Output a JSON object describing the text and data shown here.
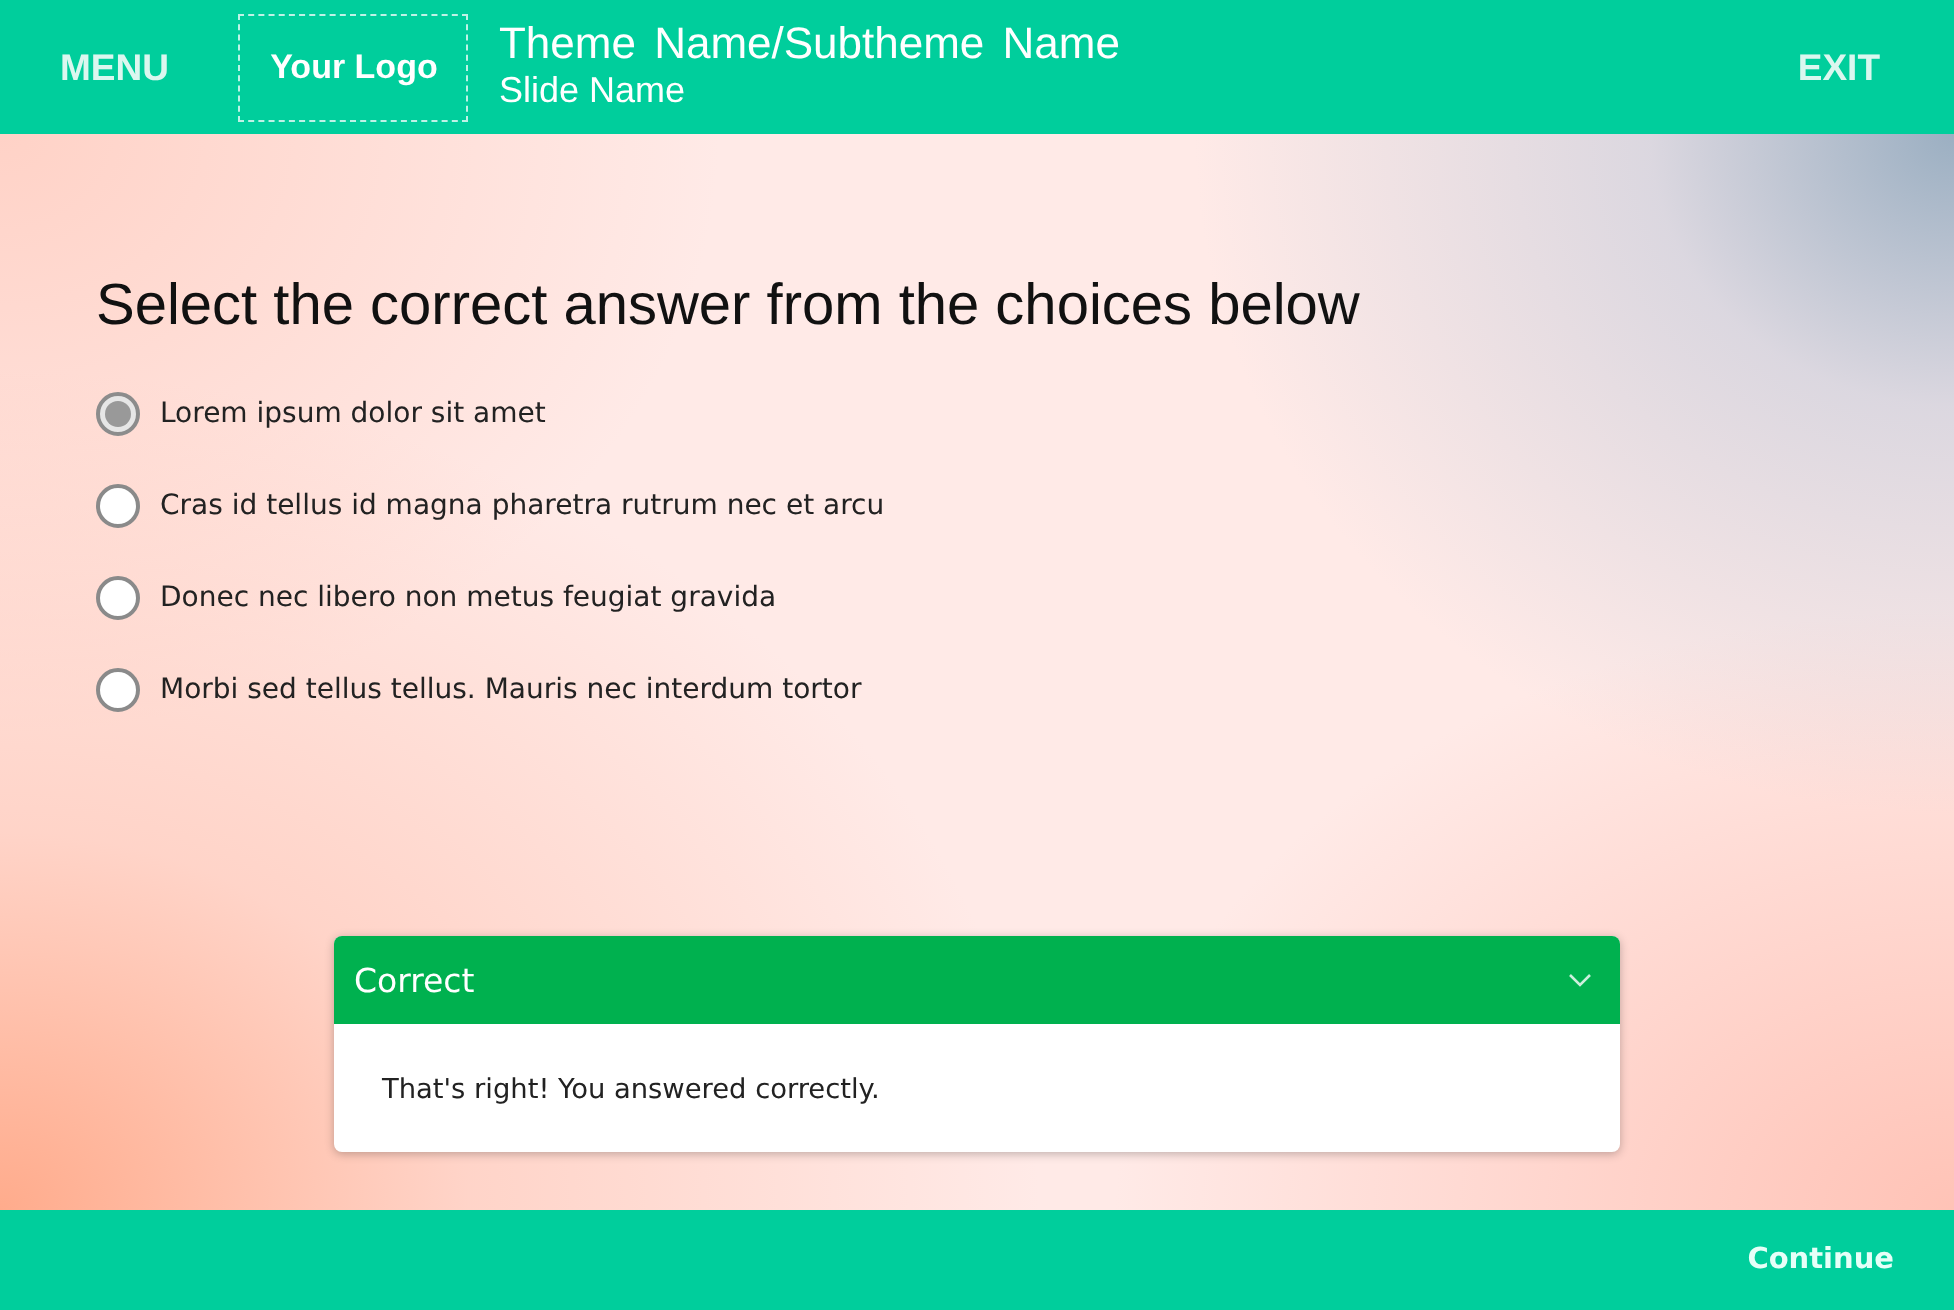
{
  "header": {
    "menu": "MENU",
    "logo": "Your Logo",
    "title": "Theme Name/Subtheme Name",
    "subtitle": "Slide Name",
    "exit": "EXIT"
  },
  "question": {
    "prompt": "Select the correct answer from the choices below",
    "choices": [
      {
        "label": "Lorem ipsum dolor sit amet",
        "selected": true
      },
      {
        "label": "Cras id tellus id magna pharetra rutrum nec et arcu",
        "selected": false
      },
      {
        "label": "Donec nec libero non metus feugiat gravida",
        "selected": false
      },
      {
        "label": "Morbi sed tellus tellus. Mauris nec interdum tortor",
        "selected": false
      }
    ]
  },
  "feedback": {
    "kind": "correct",
    "title": "Correct",
    "message": "That's right! You answered correctly.",
    "expanded": true
  },
  "footer": {
    "continue": "Continue"
  }
}
